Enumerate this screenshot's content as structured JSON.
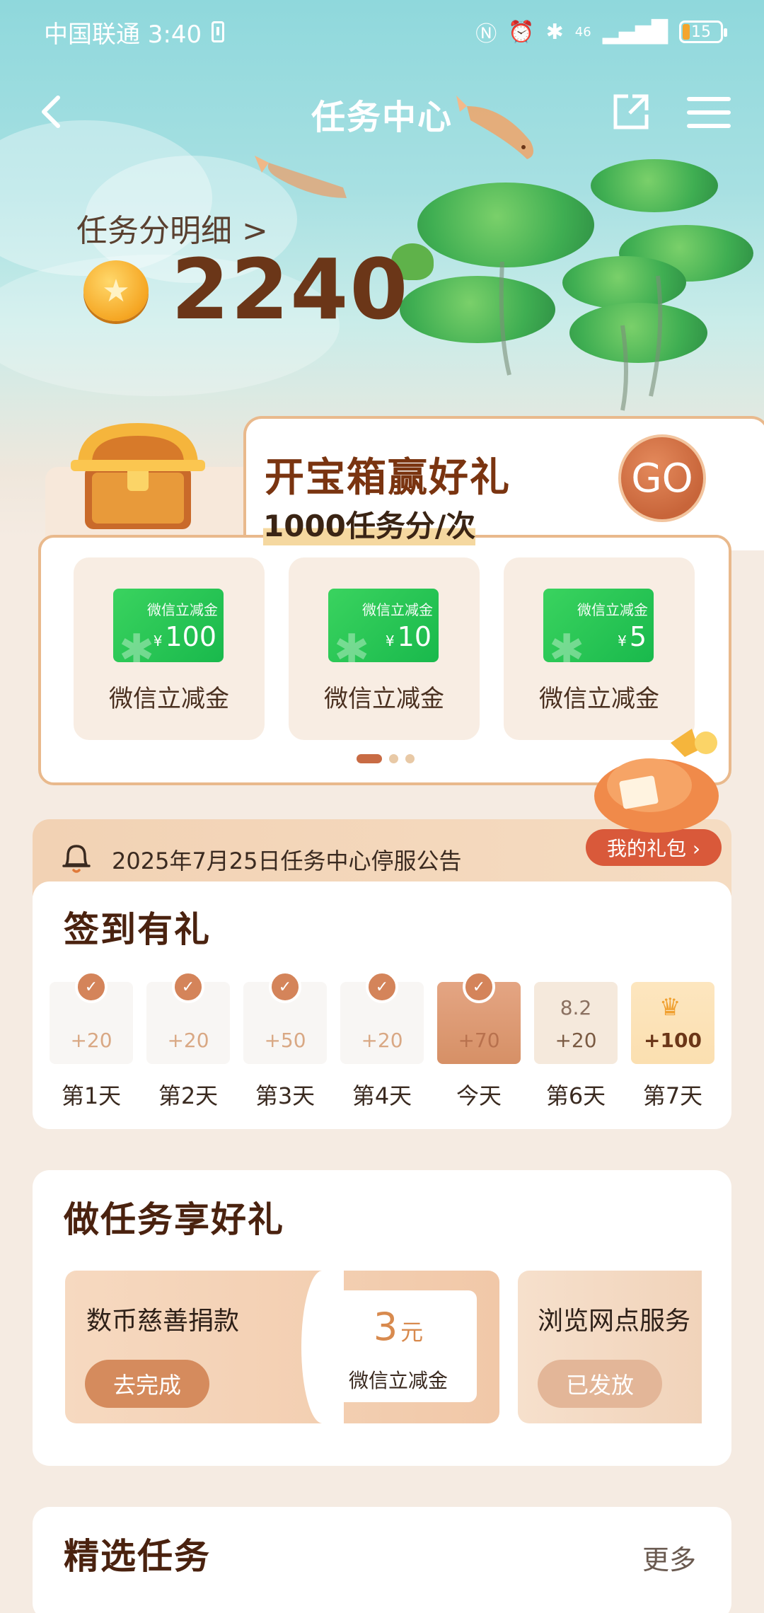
{
  "status_bar": {
    "carrier_time": "中国联通 3:40",
    "network": "46",
    "battery": "15"
  },
  "nav": {
    "title": "任务中心"
  },
  "score": {
    "label": "任务分明细  >",
    "value": "2240"
  },
  "treasure": {
    "title": "开宝箱赢好礼",
    "subtitle": "1000任务分/次",
    "go_label": "GO",
    "vouchers": [
      {
        "ticket_label": "微信立减金",
        "currency": "¥",
        "amount": "100",
        "name": "微信立减金"
      },
      {
        "ticket_label": "微信立减金",
        "currency": "¥",
        "amount": "10",
        "name": "微信立减金"
      },
      {
        "ticket_label": "微信立减金",
        "currency": "¥",
        "amount": "5",
        "name": "微信立减金"
      }
    ]
  },
  "notice": {
    "text": "2025年7月25日任务中心停服公告",
    "my_gift": "我的礼包 ›"
  },
  "checkin": {
    "title": "签到有礼",
    "days": [
      {
        "label": "第1天",
        "points": "+20",
        "state": "done"
      },
      {
        "label": "第2天",
        "points": "+20",
        "state": "done"
      },
      {
        "label": "第3天",
        "points": "+50",
        "state": "done"
      },
      {
        "label": "第4天",
        "points": "+20",
        "state": "done"
      },
      {
        "label": "今天",
        "points": "+70",
        "state": "today"
      },
      {
        "label": "第6天",
        "points": "+20",
        "state": "upcoming",
        "date": "8.2"
      },
      {
        "label": "第7天",
        "points": "+100",
        "state": "bonus"
      }
    ]
  },
  "tasks": {
    "title": "做任务享好礼",
    "items": [
      {
        "name": "数币慈善捐款",
        "button": "去完成",
        "reward_amount": "3",
        "reward_unit": "元",
        "reward_name": "微信立减金"
      },
      {
        "name": "浏览网点服务",
        "button": "已发放"
      }
    ]
  },
  "featured": {
    "title": "精选任务",
    "more": "更多"
  },
  "colors": {
    "brand_brown": "#6b3618",
    "accent_orange": "#d58b5d",
    "wechat_green": "#19b94c",
    "notice_red": "#d9593a"
  }
}
